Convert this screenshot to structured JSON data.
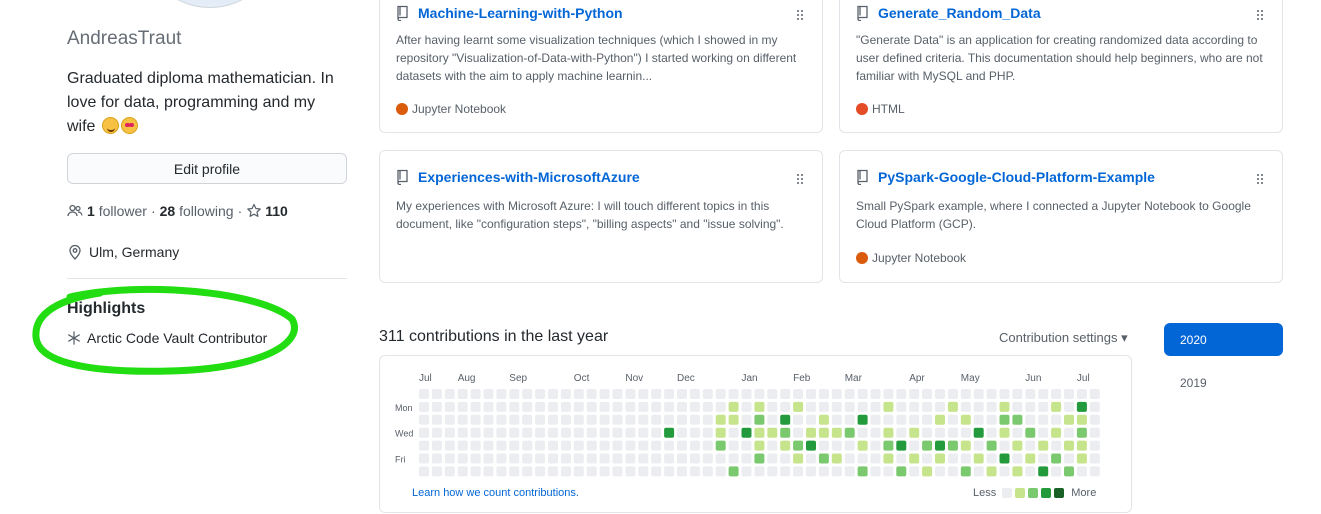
{
  "profile": {
    "username": "AndreasTraut",
    "bio": "Graduated diploma mathematician. In love for data, programming and my wife",
    "edit_label": "Edit profile",
    "followers_count": "1",
    "followers_label": "follower",
    "following_count": "28",
    "following_label": "following",
    "stars_count": "110",
    "location": "Ulm, Germany"
  },
  "highlights": {
    "title": "Highlights",
    "item": "Arctic Code Vault Contributor"
  },
  "repos": [
    {
      "name": "Machine-Learning-with-Python",
      "desc": "After having learnt some visualization techniques (which I showed in my repository \"Visualization-of-Data-with-Python\") I started working on different datasets with the aim to apply machine learnin...",
      "lang": "Jupyter Notebook",
      "lang_color": "#DA5B0B"
    },
    {
      "name": "Generate_Random_Data",
      "desc": "\"Generate Data\" is an application for creating randomized data according to user defined criteria. This documentation should help beginners, who are not familiar with MySQL and PHP.",
      "lang": "HTML",
      "lang_color": "#e34c26"
    },
    {
      "name": "Experiences-with-MicrosoftAzure",
      "desc": "My experiences with Microsoft Azure: I will touch different topics in this document, like \"configuration steps\", \"billing aspects\" and \"issue solving\".",
      "lang": "",
      "lang_color": ""
    },
    {
      "name": "PySpark-Google-Cloud-Platform-Example",
      "desc": "Small PySpark example, where I connected a Jupyter Notebook to Google Cloud Platform (GCP).",
      "lang": "Jupyter Notebook",
      "lang_color": "#DA5B0B"
    }
  ],
  "contributions": {
    "title": "311 contributions in the last year",
    "settings_label": "Contribution settings ▾",
    "months": [
      "Jul",
      "Aug",
      "Sep",
      "Oct",
      "Nov",
      "Dec",
      "Jan",
      "Feb",
      "Mar",
      "Apr",
      "May",
      "Jun",
      "Jul"
    ],
    "days": [
      "Mon",
      "Wed",
      "Fri"
    ],
    "learn_label": "Learn how we count contributions.",
    "legend_less": "Less",
    "legend_more": "More",
    "level_colors": [
      "#ebedf0",
      "#c6e48b",
      "#7bc96f",
      "#239a3b",
      "#196127"
    ],
    "active_cells": [
      [
        3,
        19
      ],
      [
        2,
        23
      ],
      [
        3,
        23
      ],
      [
        4,
        23
      ],
      [
        1,
        24
      ],
      [
        2,
        24
      ],
      [
        6,
        24
      ],
      [
        3,
        25
      ],
      [
        1,
        26
      ],
      [
        2,
        26
      ],
      [
        3,
        26
      ],
      [
        4,
        26
      ],
      [
        5,
        26
      ],
      [
        3,
        27
      ],
      [
        2,
        28
      ],
      [
        3,
        28
      ],
      [
        4,
        28
      ],
      [
        1,
        29
      ],
      [
        4,
        29
      ],
      [
        5,
        29
      ],
      [
        3,
        30
      ],
      [
        4,
        30
      ],
      [
        2,
        31
      ],
      [
        3,
        31
      ],
      [
        5,
        31
      ],
      [
        3,
        32
      ],
      [
        5,
        32
      ],
      [
        3,
        33
      ],
      [
        2,
        34
      ],
      [
        4,
        34
      ],
      [
        6,
        34
      ],
      [
        1,
        36
      ],
      [
        3,
        36
      ],
      [
        4,
        36
      ],
      [
        5,
        36
      ],
      [
        4,
        37
      ],
      [
        6,
        37
      ],
      [
        3,
        38
      ],
      [
        5,
        38
      ],
      [
        4,
        39
      ],
      [
        6,
        39
      ],
      [
        2,
        40
      ],
      [
        4,
        40
      ],
      [
        5,
        40
      ],
      [
        1,
        41
      ],
      [
        4,
        41
      ],
      [
        2,
        42
      ],
      [
        4,
        42
      ],
      [
        6,
        42
      ],
      [
        3,
        43
      ],
      [
        5,
        43
      ],
      [
        4,
        44
      ],
      [
        6,
        44
      ],
      [
        1,
        45
      ],
      [
        2,
        45
      ],
      [
        3,
        45
      ],
      [
        5,
        45
      ],
      [
        2,
        46
      ],
      [
        4,
        46
      ],
      [
        6,
        46
      ],
      [
        3,
        47
      ],
      [
        5,
        47
      ],
      [
        4,
        48
      ],
      [
        6,
        48
      ],
      [
        1,
        49
      ],
      [
        3,
        49
      ],
      [
        5,
        49
      ],
      [
        2,
        50
      ],
      [
        4,
        50
      ],
      [
        6,
        50
      ],
      [
        1,
        51
      ],
      [
        2,
        51
      ],
      [
        3,
        51
      ],
      [
        4,
        51
      ],
      [
        5,
        51
      ]
    ],
    "years": [
      "2020",
      "2019"
    ]
  }
}
